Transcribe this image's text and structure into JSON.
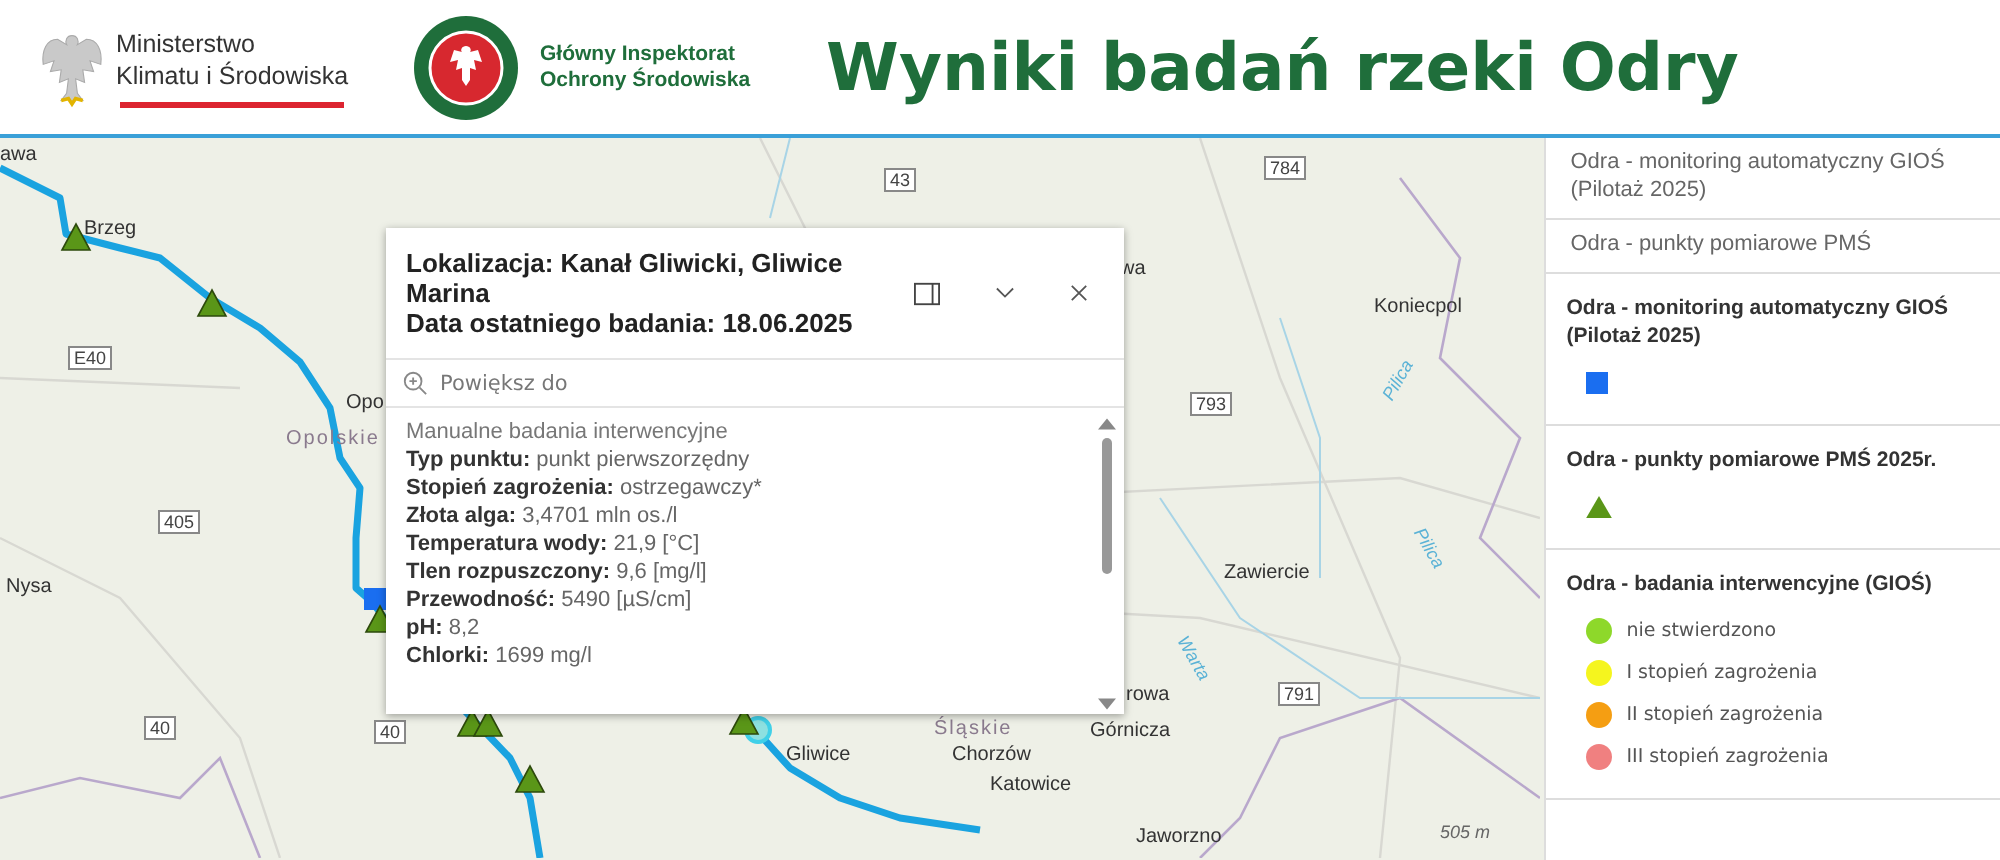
{
  "header": {
    "ministry_lines": [
      "Ministerstwo",
      "Klimatu i Środowiska"
    ],
    "inspectorate_lines": [
      "Główny Inspektorat",
      "Ochrony Środowiska"
    ],
    "title": "Wyniki badań rzeki Odry"
  },
  "map": {
    "labels": [
      {
        "kind": "city",
        "text": "awa"
      },
      {
        "kind": "city",
        "text": "Brzeg"
      },
      {
        "kind": "road",
        "text": "E40"
      },
      {
        "kind": "city",
        "text": "Opo"
      },
      {
        "kind": "region",
        "text": "Opolskie"
      },
      {
        "kind": "road",
        "text": "405"
      },
      {
        "kind": "city",
        "text": "Nysa"
      },
      {
        "kind": "road",
        "text": "40"
      },
      {
        "kind": "road",
        "text": "40"
      },
      {
        "kind": "road",
        "text": "43"
      },
      {
        "kind": "road",
        "text": "784"
      },
      {
        "kind": "city",
        "text": "wa"
      },
      {
        "kind": "city",
        "text": "Koniecpol"
      },
      {
        "kind": "river",
        "text": "Pilica"
      },
      {
        "kind": "road",
        "text": "793"
      },
      {
        "kind": "river",
        "text": "Pilica"
      },
      {
        "kind": "river",
        "text": "Warta"
      },
      {
        "kind": "city",
        "text": "Zawiercie"
      },
      {
        "kind": "road",
        "text": "791"
      },
      {
        "kind": "city",
        "text": "rowa"
      },
      {
        "kind": "region",
        "text": "Śląskie"
      },
      {
        "kind": "city",
        "text": "Górnicza"
      },
      {
        "kind": "city",
        "text": "Chorzów"
      },
      {
        "kind": "city",
        "text": "Gliwice"
      },
      {
        "kind": "city",
        "text": "Katowice"
      },
      {
        "kind": "city",
        "text": "Jaworzno"
      },
      {
        "kind": "scale",
        "text": "505 m"
      }
    ]
  },
  "popup": {
    "title_lines": [
      "Lokalizacja: Kanał Gliwicki, Gliwice Marina",
      "Data ostatniego badania: 18.06.2025"
    ],
    "zoom_action": "Powiększ do",
    "section": "Manualne badania interwencyjne",
    "fields": [
      {
        "label": "Typ punktu:",
        "value": "punkt pierwszorzędny"
      },
      {
        "label": "Stopień zagrożenia:",
        "value": "ostrzegawczy*"
      },
      {
        "label": "Złota alga:",
        "value": "3,4701 mln os./l"
      },
      {
        "label": "Temperatura wody:",
        "value": "21,9 [°C]"
      },
      {
        "label": "Tlen rozpuszczony:",
        "value": "9,6 [mg/l]"
      },
      {
        "label": "Przewodność:",
        "value": "5490 [µS/cm]"
      },
      {
        "label": "pH:",
        "value": "8,2"
      },
      {
        "label": "Chlorki:",
        "value": "1699 mg/l"
      }
    ]
  },
  "layers": [
    {
      "label": "Odra - monitoring automatyczny GIOŚ (Pilotaż 2025)"
    },
    {
      "label": "Odra - punkty pomiarowe PMŚ"
    }
  ],
  "legend": [
    {
      "title": "Odra - monitoring automatyczny GIOŚ (Pilotaż 2025)",
      "symbols": [
        {
          "kind": "square",
          "color": "#1a6ef0"
        }
      ]
    },
    {
      "title": "Odra - punkty pomiarowe PMŚ 2025r.",
      "symbols": [
        {
          "kind": "triangle",
          "color": "#5a9618"
        }
      ]
    },
    {
      "title": "Odra - badania interwencyjne (GIOŚ)",
      "symbols": [
        {
          "kind": "circle",
          "color": "#8ed82a",
          "label": "nie stwierdzono"
        },
        {
          "kind": "circle",
          "color": "#f5f51e",
          "label": "I stopień zagrożenia"
        },
        {
          "kind": "circle",
          "color": "#f59e12",
          "label": "II stopień zagrożenia"
        },
        {
          "kind": "circle",
          "color": "#f08080",
          "label": "III stopień zagrożenia"
        }
      ]
    }
  ]
}
